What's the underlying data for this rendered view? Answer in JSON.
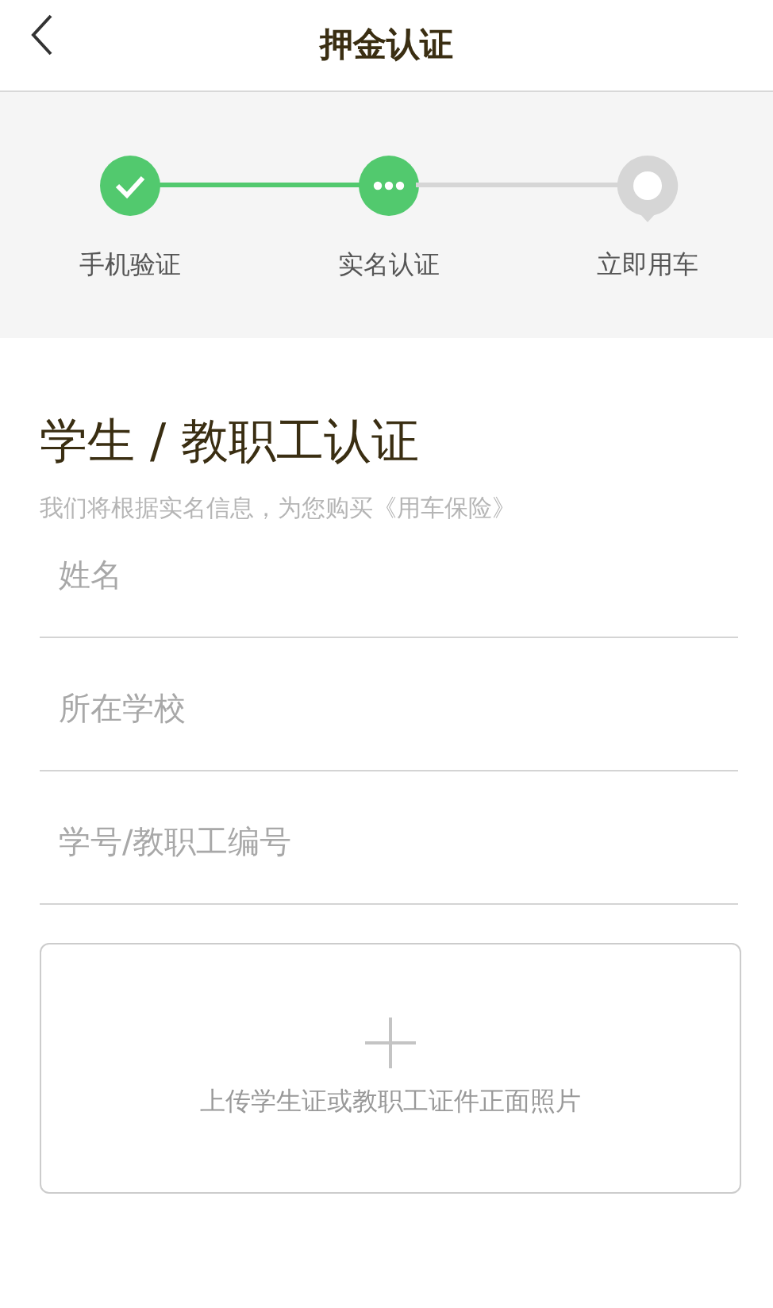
{
  "header": {
    "title": "押金认证"
  },
  "steps": [
    {
      "label": "手机验证",
      "kind": "done"
    },
    {
      "label": "实名认证",
      "kind": "current"
    },
    {
      "label": "立即用车",
      "kind": "pending"
    }
  ],
  "form": {
    "title": "学生 / 教职工认证",
    "subtitle": "我们将根据实名信息，为您购买《用车保险》",
    "fields": [
      {
        "placeholder": "姓名"
      },
      {
        "placeholder": "所在学校"
      },
      {
        "placeholder": "学号/教职工编号"
      }
    ],
    "upload": {
      "label": "上传学生证或教职工证件正面照片"
    }
  }
}
